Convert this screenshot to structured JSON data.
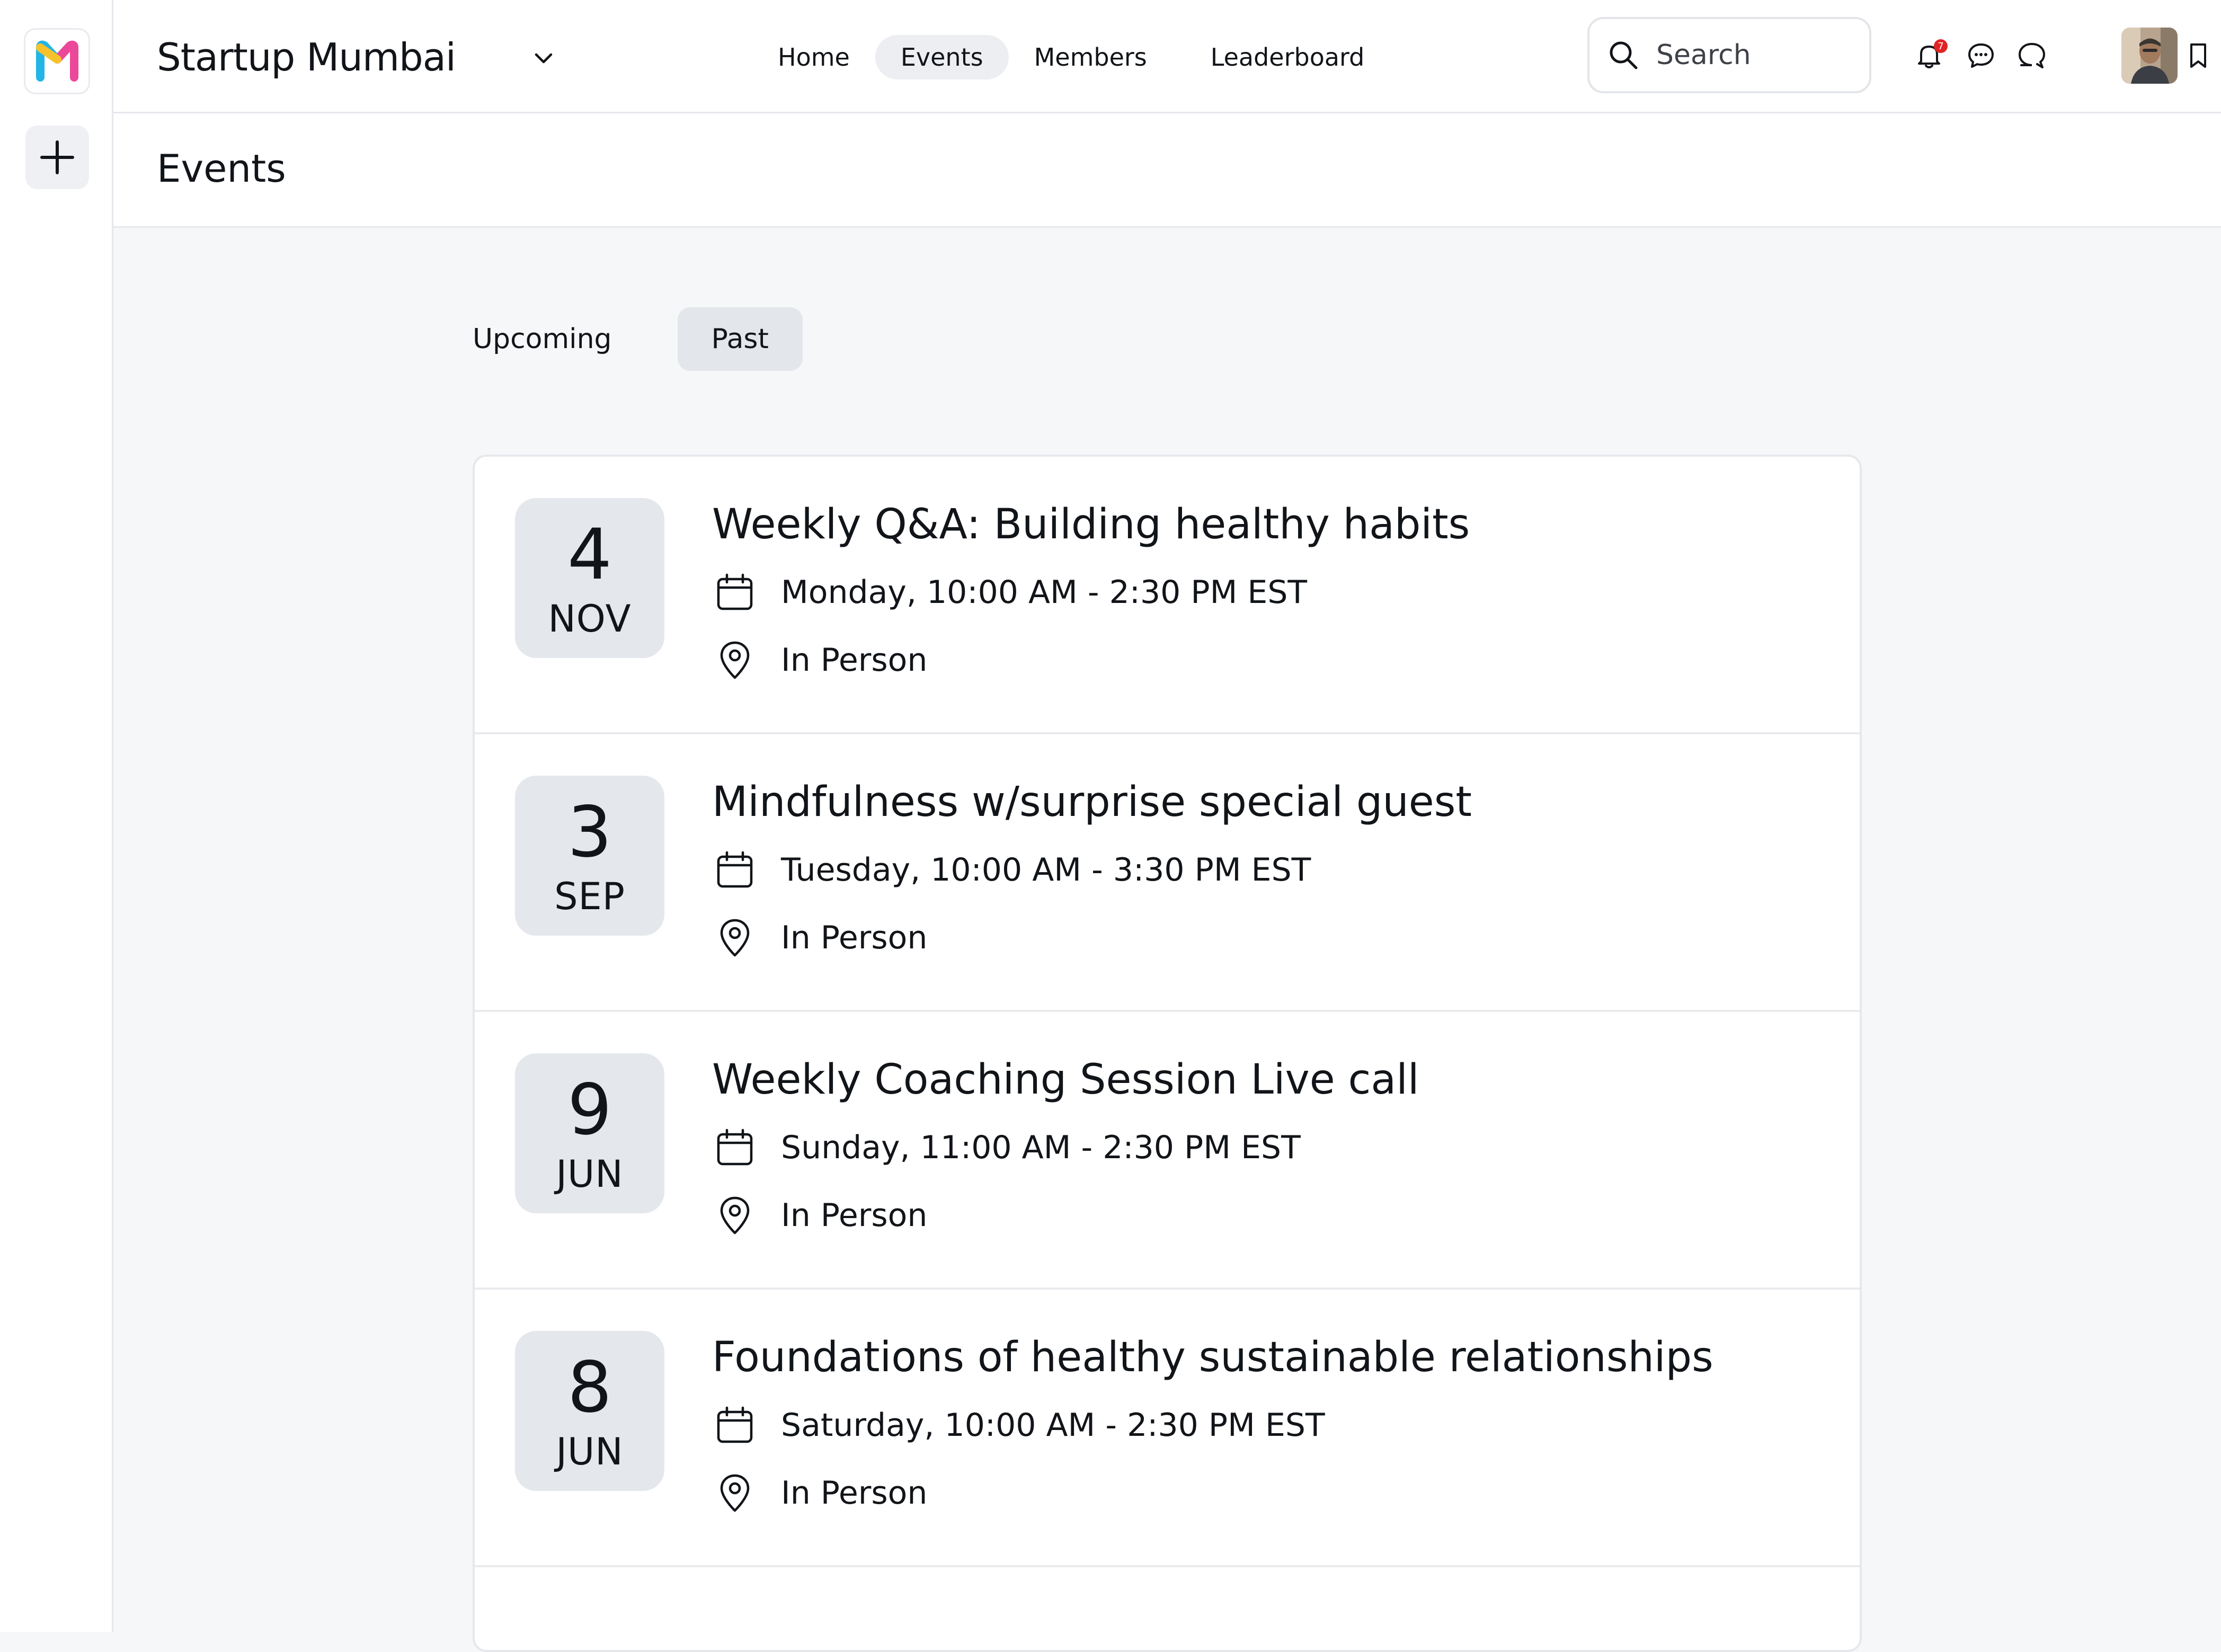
{
  "app": {
    "community_name": "Startup Mumbai",
    "brand_colors": {
      "logo_yellow": "#f7c22b",
      "logo_pink": "#ec4899",
      "logo_blue": "#22b5e6",
      "notification": "#e02424"
    }
  },
  "nav": {
    "items": [
      {
        "label": "Home"
      },
      {
        "label": "Events"
      },
      {
        "label": "Members"
      },
      {
        "label": "Leaderboard"
      }
    ],
    "active": "Events"
  },
  "search": {
    "placeholder": "Search"
  },
  "toolbar": {
    "notification_count": "7",
    "icons": [
      "bell-icon",
      "chat-bubble-icon",
      "messages-icon",
      "bookmark-icon"
    ]
  },
  "page": {
    "title": "Events"
  },
  "tabs": {
    "items": [
      {
        "label": "Upcoming"
      },
      {
        "label": "Past"
      }
    ],
    "active": "Past"
  },
  "events": [
    {
      "day": "4",
      "month": "NOV",
      "title": "Weekly Q&A: Building healthy habits",
      "time": "Monday, 10:00 AM - 2:30 PM EST",
      "location": "In Person"
    },
    {
      "day": "3",
      "month": "SEP",
      "title": "Mindfulness w/surprise special guest",
      "time": "Tuesday, 10:00 AM - 3:30 PM EST",
      "location": "In Person"
    },
    {
      "day": "9",
      "month": "JUN",
      "title": "Weekly Coaching Session Live call",
      "time": "Sunday, 11:00 AM - 2:30 PM EST",
      "location": "In Person"
    },
    {
      "day": "8",
      "month": "JUN",
      "title": "Foundations of healthy sustainable relationships",
      "time": "Saturday, 10:00 AM - 2:30 PM EST",
      "location": "In Person"
    }
  ]
}
